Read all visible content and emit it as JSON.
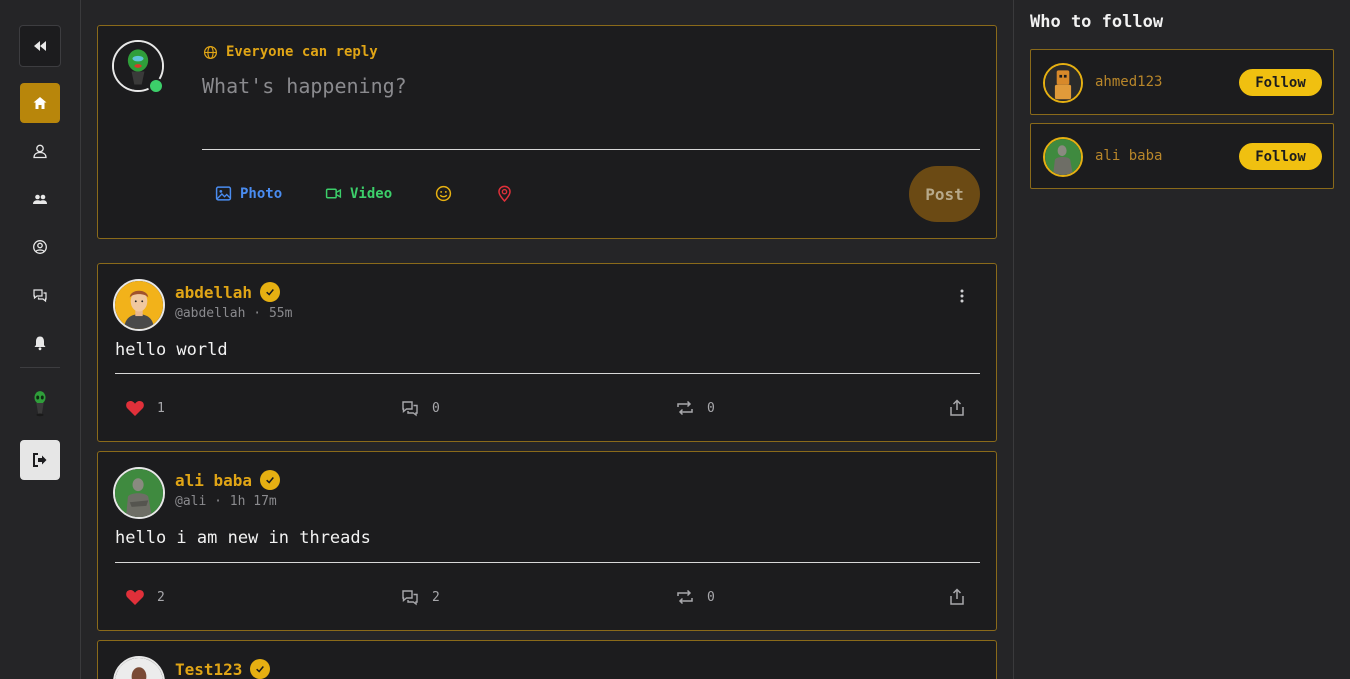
{
  "composer": {
    "reply_setting": "Everyone can reply",
    "placeholder": "What's happening?",
    "photo_label": "Photo",
    "video_label": "Video",
    "post_label": "Post"
  },
  "posts": [
    {
      "name": "abdellah",
      "handle": "@abdellah",
      "time": "55m",
      "text": "hello world",
      "likes": "1",
      "comments": "0",
      "reposts": "0"
    },
    {
      "name": "ali baba",
      "handle": "@ali",
      "time": "1h 17m",
      "text": "hello i am new in threads",
      "likes": "2",
      "comments": "2",
      "reposts": "0"
    },
    {
      "name": "Test123"
    }
  ],
  "who_to_follow": {
    "title": "Who to follow",
    "users": [
      {
        "name": "ahmed123",
        "follow_label": "Follow"
      },
      {
        "name": "ali baba",
        "follow_label": "Follow"
      }
    ]
  },
  "meta_separator": "·",
  "colors": {
    "accent": "#e0a516",
    "card_border": "#8a6a1a",
    "follow_button": "#f0c010",
    "like": "#e0303a",
    "photo": "#4a8cf0",
    "video": "#3ccf6a",
    "online": "#3ccf6a"
  }
}
